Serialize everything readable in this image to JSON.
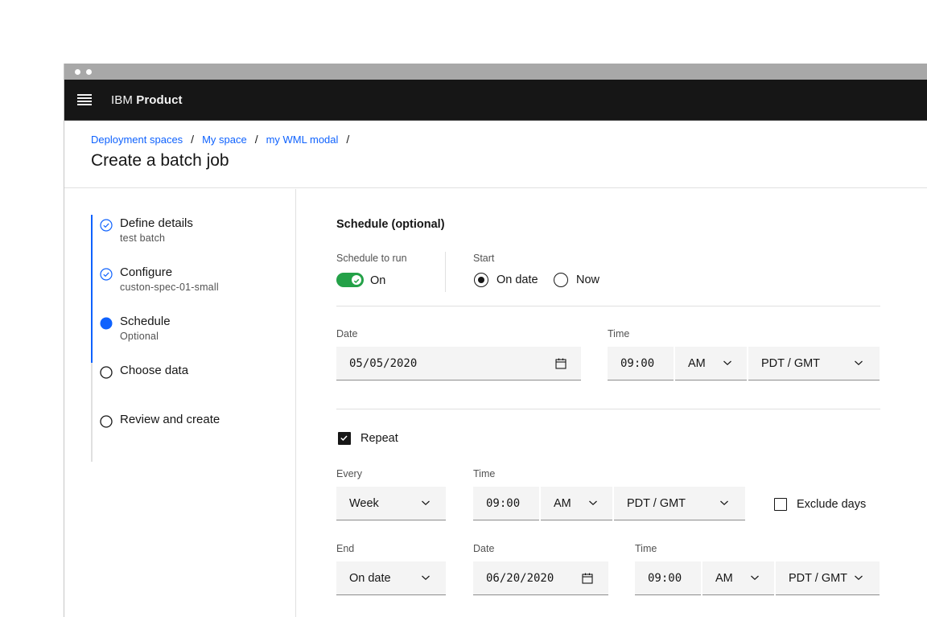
{
  "app": {
    "brand_prefix": "IBM",
    "brand_name": "Product"
  },
  "breadcrumb": [
    {
      "label": "Deployment spaces"
    },
    {
      "label": "My space"
    },
    {
      "label": "my WML modal"
    }
  ],
  "breadcrumb_separator": "/",
  "page_title": "Create a batch job",
  "steps": [
    {
      "label": "Define details",
      "sub": "test batch",
      "state": "complete"
    },
    {
      "label": "Configure",
      "sub": "custon-spec-01-small",
      "state": "complete"
    },
    {
      "label": "Schedule",
      "sub": "Optional",
      "state": "current"
    },
    {
      "label": "Choose data",
      "sub": "",
      "state": "incomplete"
    },
    {
      "label": "Review and create",
      "sub": "",
      "state": "incomplete"
    }
  ],
  "schedule": {
    "title": "Schedule (optional)",
    "run_label": "Schedule to run",
    "toggle_state": "On",
    "start_label": "Start",
    "start_options": [
      "On date",
      "Now"
    ],
    "start_selected": "On date",
    "date_label": "Date",
    "date_value": "05/05/2020",
    "time_label": "Time",
    "time_value": "09:00",
    "ampm": "AM",
    "timezone": "PDT / GMT"
  },
  "repeat": {
    "label": "Repeat",
    "checked": true,
    "every_label": "Every",
    "every_value": "Week",
    "time_label": "Time",
    "time_value": "09:00",
    "ampm": "AM",
    "timezone": "PDT / GMT",
    "exclude_label": "Exclude days",
    "exclude_checked": false
  },
  "end": {
    "end_label": "End",
    "end_value": "On date",
    "date_label": "Date",
    "date_value": "06/20/2020",
    "time_label": "Time",
    "time_value": "09:00",
    "ampm": "AM",
    "timezone": "PDT / GMT"
  },
  "colors": {
    "accent": "#0f62fe",
    "toggle_on": "#24a148",
    "header_bg": "#161616",
    "field_bg": "#f4f4f4"
  }
}
